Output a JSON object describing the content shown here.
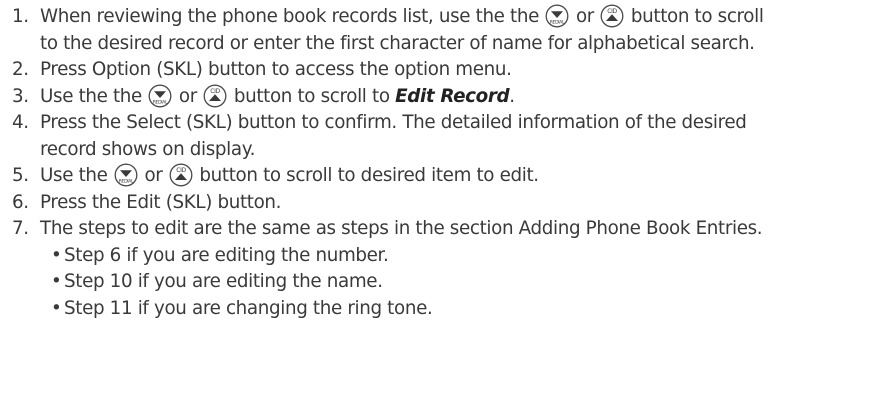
{
  "steps": [
    {
      "num": "1.",
      "t1": "When reviewing the phone book records list, use the the",
      "t2": "or",
      "t3": "button to scroll",
      "line2": "to the desired record or enter the first character of name for alphabetical search."
    },
    {
      "num": "2.",
      "text": "Press Option (SKL) button to access the option menu."
    },
    {
      "num": "3.",
      "t1": "Use the the",
      "t2": "or",
      "t3": "button to scroll to",
      "emphasis": "Edit Record",
      "t4": "."
    },
    {
      "num": "4.",
      "line1": "Press the Select (SKL) button to confirm. The detailed information of the desired",
      "line2": "record shows on display."
    },
    {
      "num": "5.",
      "t1": "Use the",
      "t2": "or",
      "t3": "button to scroll to desired item to edit."
    },
    {
      "num": "6.",
      "text": "Press the Edit (SKL) button."
    },
    {
      "num": "7.",
      "text": "The steps to edit are the same as steps in the section Adding Phone Book Entries.",
      "sub": [
        "Step 6 if you are editing the number.",
        "Step 10 if you are editing the name.",
        "Step 11 if you are changing the ring tone."
      ]
    }
  ],
  "icons": {
    "down": {
      "name": "redial-down-button-icon",
      "label": "REDIAL"
    },
    "up": {
      "name": "cid-up-button-icon",
      "label": "CID"
    }
  },
  "bullet_char": "•",
  "colors": {
    "text": "#3a3a3a",
    "icon_stroke": "#4a4a4a",
    "icon_fill": "#3a3a3a"
  }
}
